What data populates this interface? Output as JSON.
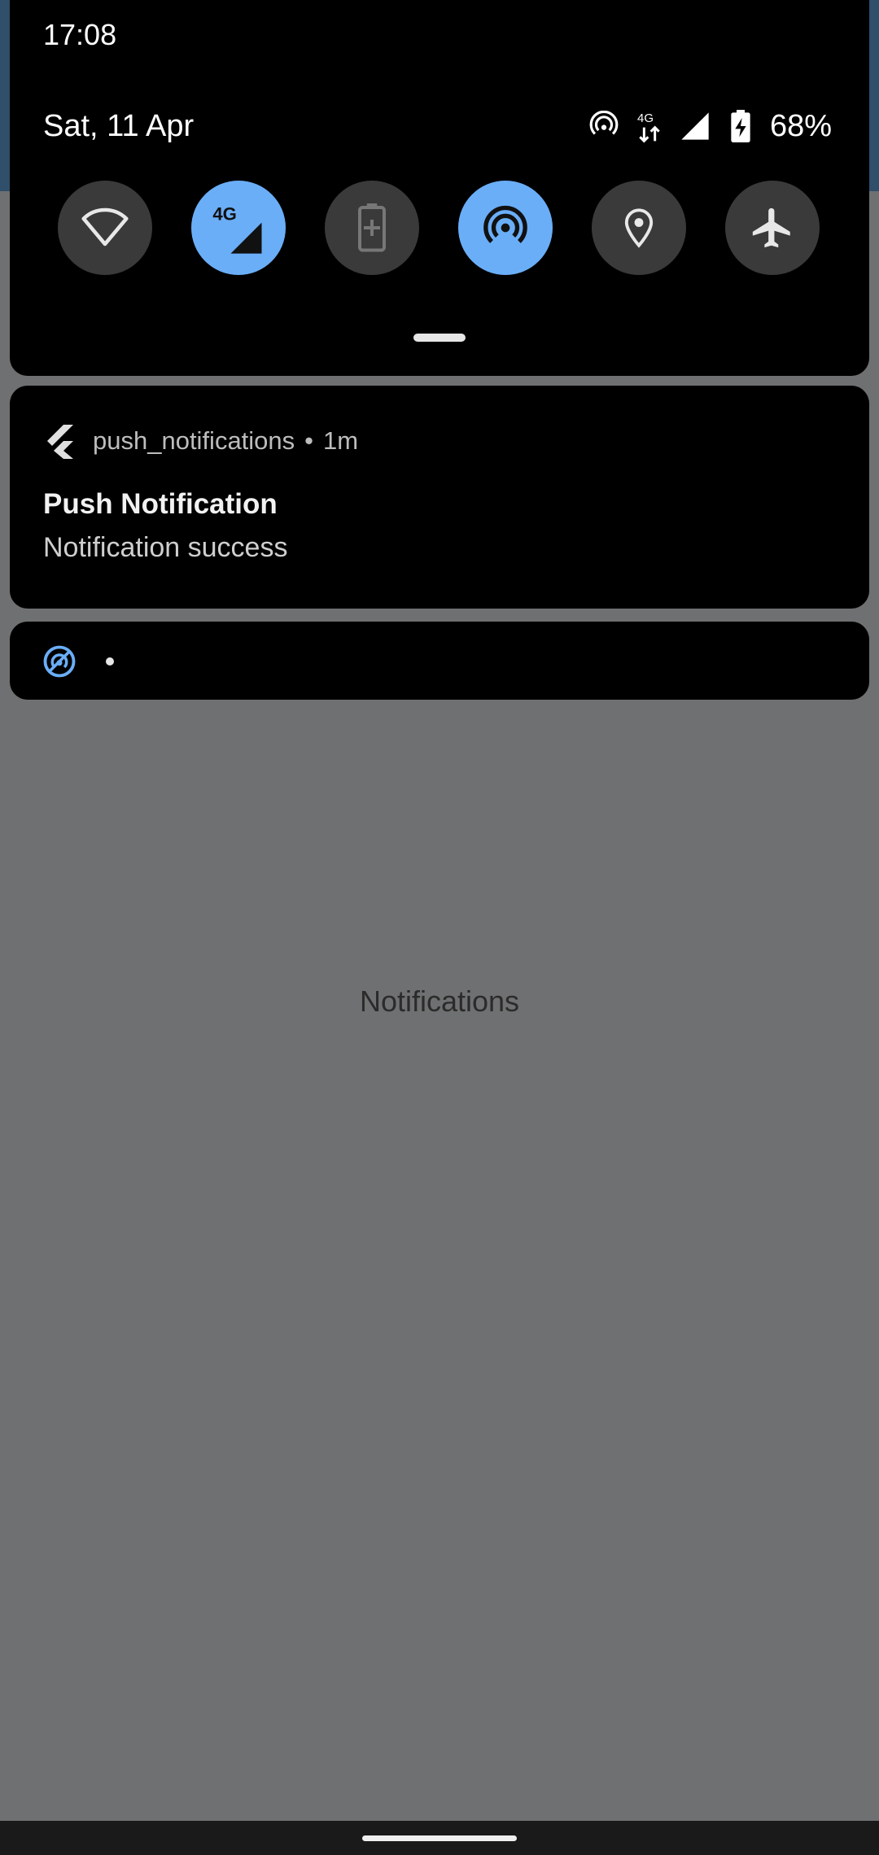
{
  "status_bar": {
    "time": "17:08"
  },
  "shade": {
    "date": "Sat, 11 Apr",
    "network_type": "4G",
    "battery_percent": "68%",
    "quick_tiles": [
      {
        "name": "wifi",
        "icon": "wifi-icon",
        "active": false
      },
      {
        "name": "mobile-data",
        "icon": "mobile-data-4g-icon",
        "label": "4G",
        "active": true
      },
      {
        "name": "battery-saver",
        "icon": "battery-saver-icon",
        "active": false
      },
      {
        "name": "hotspot",
        "icon": "hotspot-icon",
        "active": true
      },
      {
        "name": "location",
        "icon": "location-icon",
        "active": false
      },
      {
        "name": "airplane-mode",
        "icon": "airplane-icon",
        "active": false
      }
    ]
  },
  "notifications": [
    {
      "app_name": "push_notifications",
      "time_ago": "1m",
      "separator": "•",
      "title": "Push Notification",
      "body": "Notification success",
      "icon": "flutter-logo-icon"
    },
    {
      "icon": "hotspot-notification-icon",
      "separator": "•"
    }
  ],
  "app": {
    "center_text": "Notifications"
  },
  "colors": {
    "active_tile": "#6aaef8",
    "inactive_tile": "#3a3a3a",
    "card_bg": "#000000",
    "app_bg": "#6f7071"
  }
}
